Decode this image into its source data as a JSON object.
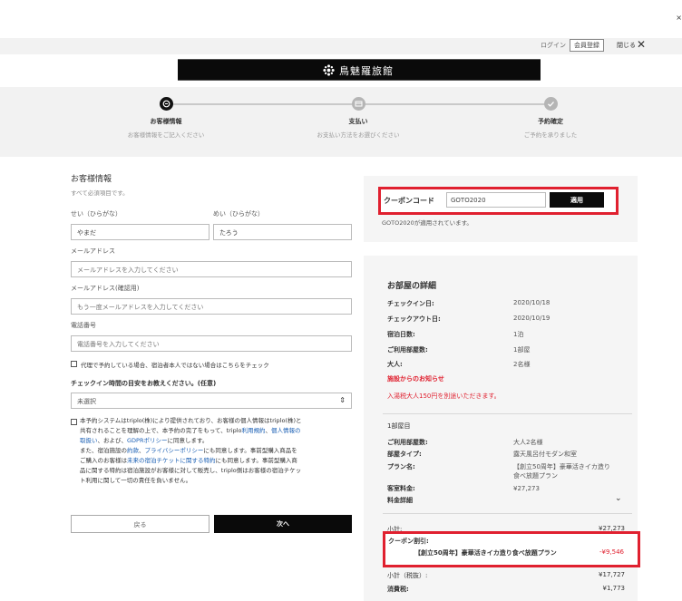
{
  "window": {
    "close_x": "×"
  },
  "topbar": {
    "login": "ログイン",
    "register": "会員登録",
    "close_label": "閉じる",
    "close_x": "✕"
  },
  "banner": {
    "hotel_name": "鳥魅羅旅館"
  },
  "steps": [
    {
      "title": "お客様情報",
      "sub": "お客様情報をご記入ください"
    },
    {
      "title": "支払い",
      "sub": "お支払い方法をお選びください"
    },
    {
      "title": "予約確定",
      "sub": "ご予約を承りました"
    }
  ],
  "form": {
    "title": "お客様情報",
    "required_note": "すべて必須項目です。",
    "last_name_label": "せい（ひらがな）",
    "last_name_value": "やまだ",
    "first_name_label": "めい（ひらがな）",
    "first_name_value": "たろう",
    "email_label": "メールアドレス",
    "email_placeholder": "メールアドレスを入力してください",
    "email_confirm_label": "メールアドレス(確認用)",
    "email_confirm_placeholder": "もう一度メールアドレスを入力してください",
    "phone_label": "電話番号",
    "phone_placeholder": "電話番号を入力してください",
    "proxy_check": "代理で予約している場合、宿泊者本人ではない場合はこちらをチェック",
    "checkin_label": "チェックイン時間の目安をお教えください。(任意)",
    "checkin_value": "未選択",
    "consent_1": "本予約システムはtriplo(株)により提供されており、お客様の個人情報はtriplo(株)と",
    "consent_2a": "共有されることを理解の上で、本予約の完了をもって、triplo",
    "consent_2b": "利用規約",
    "consent_2c": "、",
    "consent_2d": "個人情報の",
    "consent_3a": "取扱い",
    "consent_3b": "、および、",
    "consent_3c": "GDPRポリシー",
    "consent_3d": "に同意します。",
    "consent_4a": "また、宿泊施設の",
    "consent_4b": "約款",
    "consent_4c": "、",
    "consent_4d": "プライバシーポリシー",
    "consent_4e": "にも同意します。事前型購入商品を",
    "consent_5a": "ご購入のお客様は",
    "consent_5b": "未来の宿泊チケットに関する特約",
    "consent_5c": "にも同意します。事前型購入商",
    "consent_6": "品に関する特約は宿泊施設がお客様に対して販売し、triplo側はお客様の宿泊チケッ",
    "consent_7": "ト利用に関して一切の責任を負いません。",
    "back_button": "戻る",
    "next_button": "次へ"
  },
  "coupon": {
    "label": "クーポンコード",
    "value": "GOTO2020",
    "apply": "適用",
    "message": "GOTO2020が適用されています。"
  },
  "room": {
    "title": "お部屋の詳細",
    "checkin_k": "チェックイン日:",
    "checkin_v": "2020/10/18",
    "checkout_k": "チェックアウト日:",
    "checkout_v": "2020/10/19",
    "nights_k": "宿泊日数:",
    "nights_v": "1泊",
    "rooms_k": "ご利用部屋数:",
    "rooms_v": "1部屋",
    "adults_k": "大人:",
    "adults_v": "2名様",
    "notice_title": "施設からのお知らせ",
    "notice_text": "入湯税大人150円を別途いただきます。",
    "room_no": "1部屋目",
    "guests_k": "ご利用部屋数:",
    "guests_v": "大人2名様",
    "type_k": "部屋タイプ:",
    "type_v": "露天風呂付モダン和室",
    "plan_k": "プラン名:",
    "plan_v1": "【創立50周年】豪華活きイカ造り",
    "plan_v2": "食べ放題プラン",
    "fee_k": "客室料金:",
    "fee_v": "¥27,273",
    "detail_k": "料金詳細",
    "subtotal_k": "小計:",
    "subtotal_v": "¥27,273",
    "discount_label": "クーポン割引:",
    "discount_name": "【創立50周年】豪華活きイカ造り食べ放題プラン",
    "discount_amount": "-¥9,546",
    "subtotal_tax_k": "小計（税抜）:",
    "subtotal_tax_v": "¥17,727",
    "tax_k": "消費税:",
    "tax_v": "¥1,773"
  }
}
